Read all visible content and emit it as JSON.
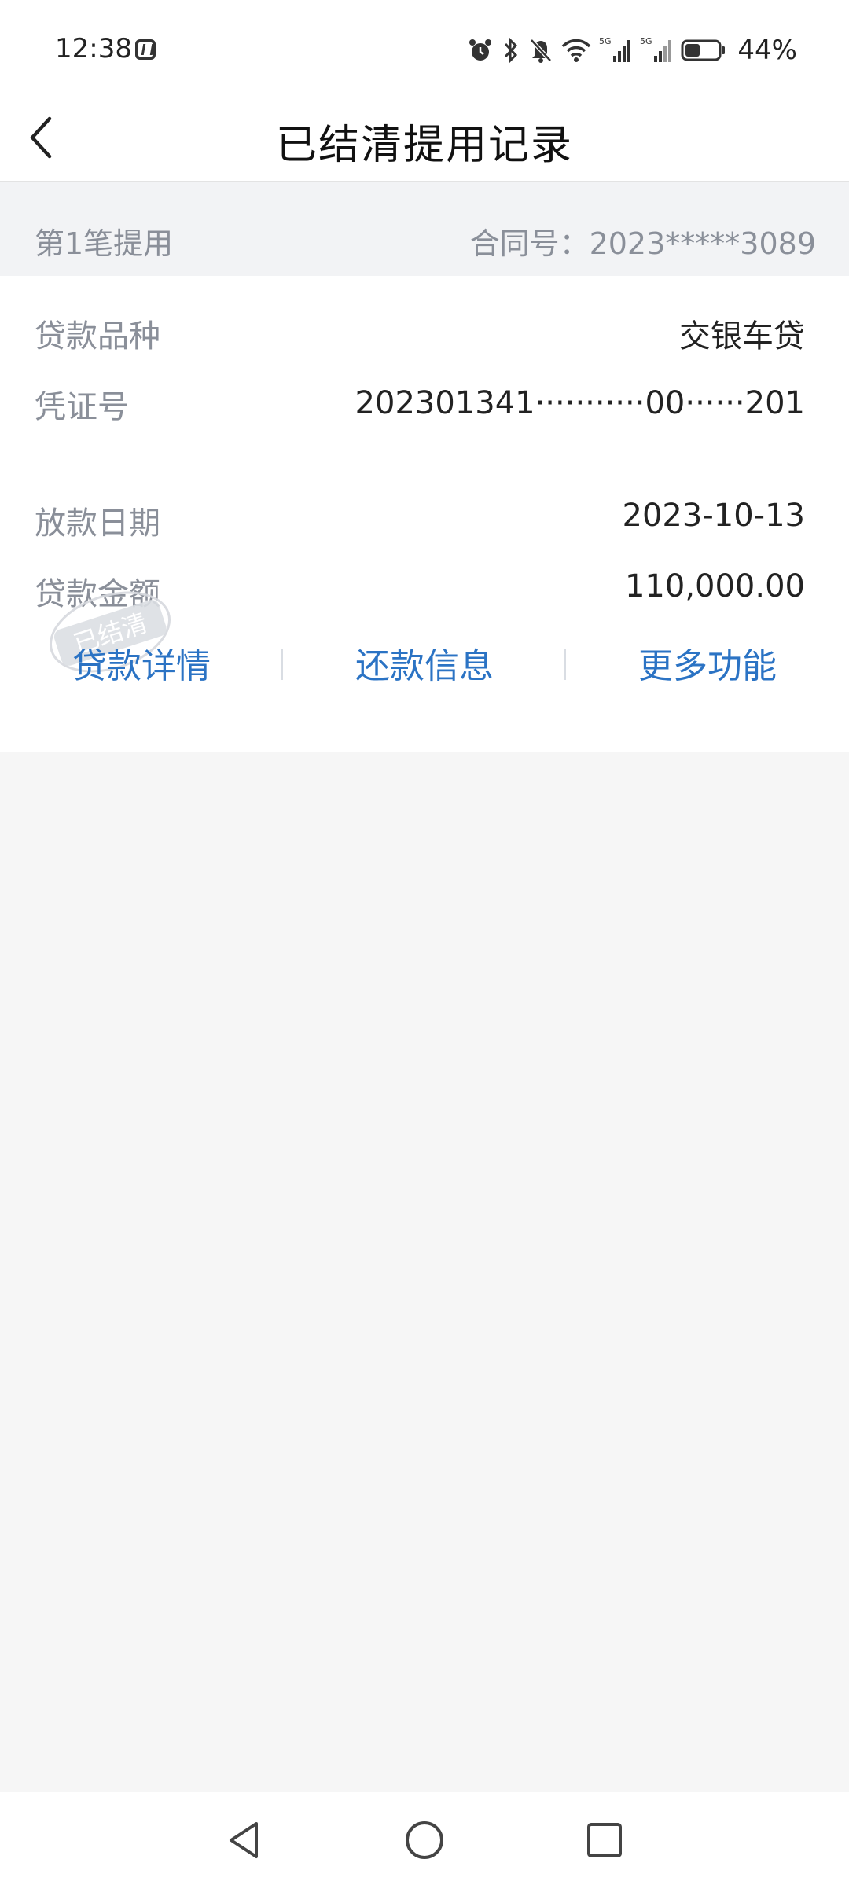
{
  "status_bar": {
    "time": "12:38",
    "battery_percent": "44%",
    "battery_level": 0.44,
    "icons": [
      "nfc-icon",
      "alarm-icon",
      "bluetooth-icon",
      "mute-icon",
      "wifi-icon",
      "signal-5g-icon",
      "signal-5g-icon",
      "battery-icon"
    ]
  },
  "header": {
    "title": "已结清提用记录",
    "back_icon": "chevron-left-icon"
  },
  "record": {
    "section_title": "第1笔提用",
    "contract_number": "合同号：2023*****3089",
    "fields": [
      {
        "label": "贷款品种",
        "value": "交银车贷"
      },
      {
        "label": "凭证号",
        "value": "202301341···········00······201"
      },
      {
        "label": "放款日期",
        "value": "2023-10-13"
      },
      {
        "label": "贷款金额",
        "value": "110,000.00"
      }
    ],
    "stamp_text": "已结清",
    "actions": [
      {
        "label": "贷款详情"
      },
      {
        "label": "还款信息"
      },
      {
        "label": "更多功能"
      }
    ]
  },
  "nav": {
    "icons": [
      "back-triangle-icon",
      "home-circle-icon",
      "recents-square-icon"
    ]
  },
  "colors": {
    "accent": "#2b73c4",
    "label_gray": "#8a8f99",
    "background": "#f6f6f6"
  }
}
